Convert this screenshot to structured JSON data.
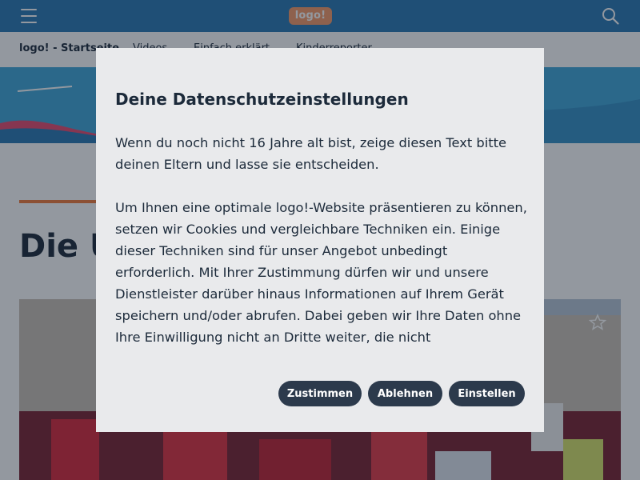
{
  "header": {
    "logo_text": "logo!",
    "menu_icon": "hamburger-icon",
    "search_icon": "search-icon"
  },
  "subnav": {
    "items": [
      {
        "label": "logo! - Startseite"
      },
      {
        "label": "Videos"
      },
      {
        "label": "Einfach erklärt"
      },
      {
        "label": "Kinderreporter"
      }
    ]
  },
  "article": {
    "title": "Die U"
  },
  "consent": {
    "title": "Deine Datenschutzeinstellungen",
    "paragraphs": [
      "Wenn du noch nicht 16 Jahre alt bist, zeige diesen Text bitte deinen Eltern und lasse sie entscheiden.",
      "Um Ihnen eine optimale logo!-Website präsentieren zu können, setzen wir Cookies und vergleichbare Techniken ein. Einige dieser Techniken sind für unser Angebot unbedingt erforderlich. Mit Ihrer Zustimmung dürfen wir und unsere Dienstleister darüber hinaus Informationen auf Ihrem Gerät speichern und/oder abrufen. Dabei geben wir Ihre Daten ohne Ihre Einwilligung nicht an Dritte weiter, die nicht"
    ],
    "buttons": {
      "accept": "Zustimmen",
      "reject": "Ablehnen",
      "settings": "Einstellen"
    }
  },
  "colors": {
    "header_bg": "#2a79b4",
    "logo_bg": "#f59a68",
    "accent": "#f27a3a",
    "button_bg": "#2c3a4c",
    "dialog_bg": "#e9eaec",
    "text": "#1c2a3a"
  },
  "icons": [
    "hamburger-icon",
    "search-icon",
    "star-icon"
  ]
}
